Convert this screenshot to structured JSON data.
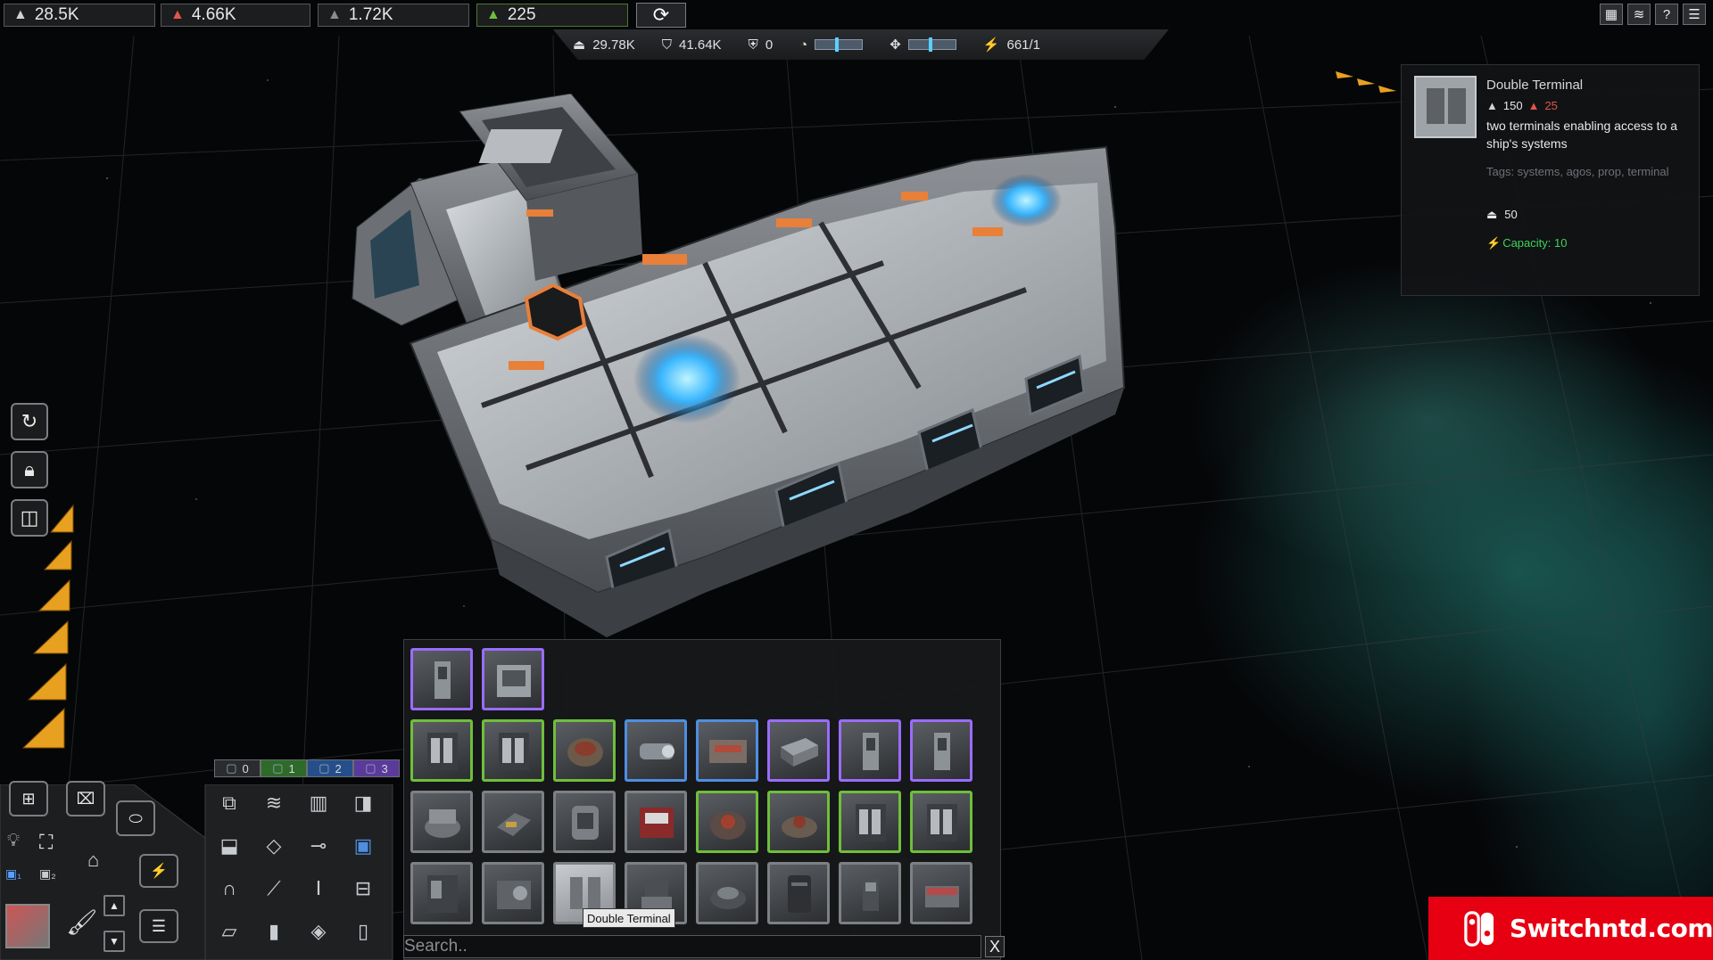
{
  "resources": [
    {
      "icon": "ore-stack-icon",
      "value": "28.5K",
      "color": "#cfd3d8"
    },
    {
      "icon": "ore-stack-icon",
      "value": "4.66K",
      "color": "#e0564a"
    },
    {
      "icon": "ore-stack-icon",
      "value": "1.72K",
      "color": "#8a8d90"
    },
    {
      "icon": "ore-stack-icon",
      "value": "225",
      "color": "#6fbf3a"
    }
  ],
  "stats": {
    "mass": "29.78K",
    "armor": "41.64K",
    "shield": "0",
    "power": "661/1"
  },
  "info_panel": {
    "title": "Double Terminal",
    "cost_primary": "150",
    "cost_secondary": "25",
    "description": "two terminals enabling access to a ship's systems",
    "tags": "Tags: systems, agos, prop, terminal",
    "weight": "50",
    "capacity": "Capacity: 10"
  },
  "builder_tabs": [
    "0",
    "1",
    "2",
    "3"
  ],
  "palette": {
    "tooltip": "Double Terminal",
    "search_placeholder": "Search..",
    "search_value": "",
    "close_label": "X"
  },
  "top_right": {
    "help_label": "?"
  },
  "watermark": {
    "text": "Switchntd.com"
  },
  "colors": {
    "accent_orange": "#e8a020",
    "panel_green": "#3fd35a",
    "cost_red": "#e0564a",
    "selection_purple": "#9a6cff",
    "selection_green": "#6fbf3a",
    "selection_blue": "#4f8ee0"
  }
}
